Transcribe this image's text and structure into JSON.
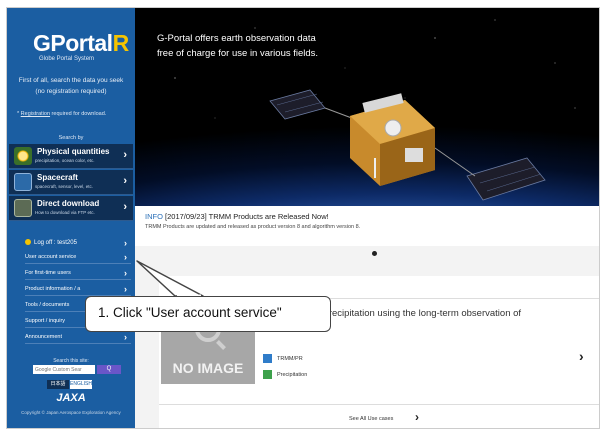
{
  "sidebar": {
    "logo_main": "GPortal",
    "logo_accent": "R",
    "logo_sub": "Globe Portal System",
    "intro": "First of all, search the data you seek (no registration required)",
    "reg_link": "Registration",
    "reg_rest": " required for download.",
    "search_by": "Search by",
    "nav": [
      {
        "title": "Physical quantities",
        "sub": "precipitation, ocean color, etc.",
        "icon": "sun-icon"
      },
      {
        "title": "Spacecraft",
        "sub": "spacecraft, sensor, level, etc.",
        "icon": "satellite-icon"
      },
      {
        "title": "Direct download",
        "sub": "How to download via FTP etc.",
        "icon": "monitor-icon"
      }
    ],
    "login": "Log off : test205",
    "rows": [
      {
        "label": "User account service"
      },
      {
        "label": "For first-time users"
      },
      {
        "label": "Product information / a"
      },
      {
        "label": "Tools / documents"
      },
      {
        "label": "Support / inquiry"
      },
      {
        "label": "Announcement"
      }
    ],
    "search_label": "Search this site:",
    "search_placeholder": "Google Custom Sear",
    "search_button": "Q",
    "lang_ja": "日本語",
    "lang_en": "ENGLISH",
    "jaxa": "JAXA",
    "copyright": "Copyright © Japan Aerospace Exploration Agency"
  },
  "hero": {
    "line1": "G-Portal offers earth observation data",
    "line2": "free of charge for use in various fields."
  },
  "info": {
    "label": "INFO",
    "headline": "[2017/09/23] TRMM Products are Released Now!",
    "detail": "TRMM Products are updated and released as product version 8 and algorithm version 8."
  },
  "card": {
    "noimage": "NO IMAGE",
    "title": "ly Variation of Precipitation using the long-term observation of TRMM/PR",
    "tag1": "TRMM/PR",
    "tag2": "Precipitation",
    "see_all": "See All Use cases"
  },
  "callout": {
    "text": "1. Click \"User account service\""
  },
  "colors": {
    "sidebar": "#1b5ea2",
    "nav_dark": "#0f2f55",
    "logo_accent": "#f5c400",
    "info_label": "#2a6fb8"
  }
}
